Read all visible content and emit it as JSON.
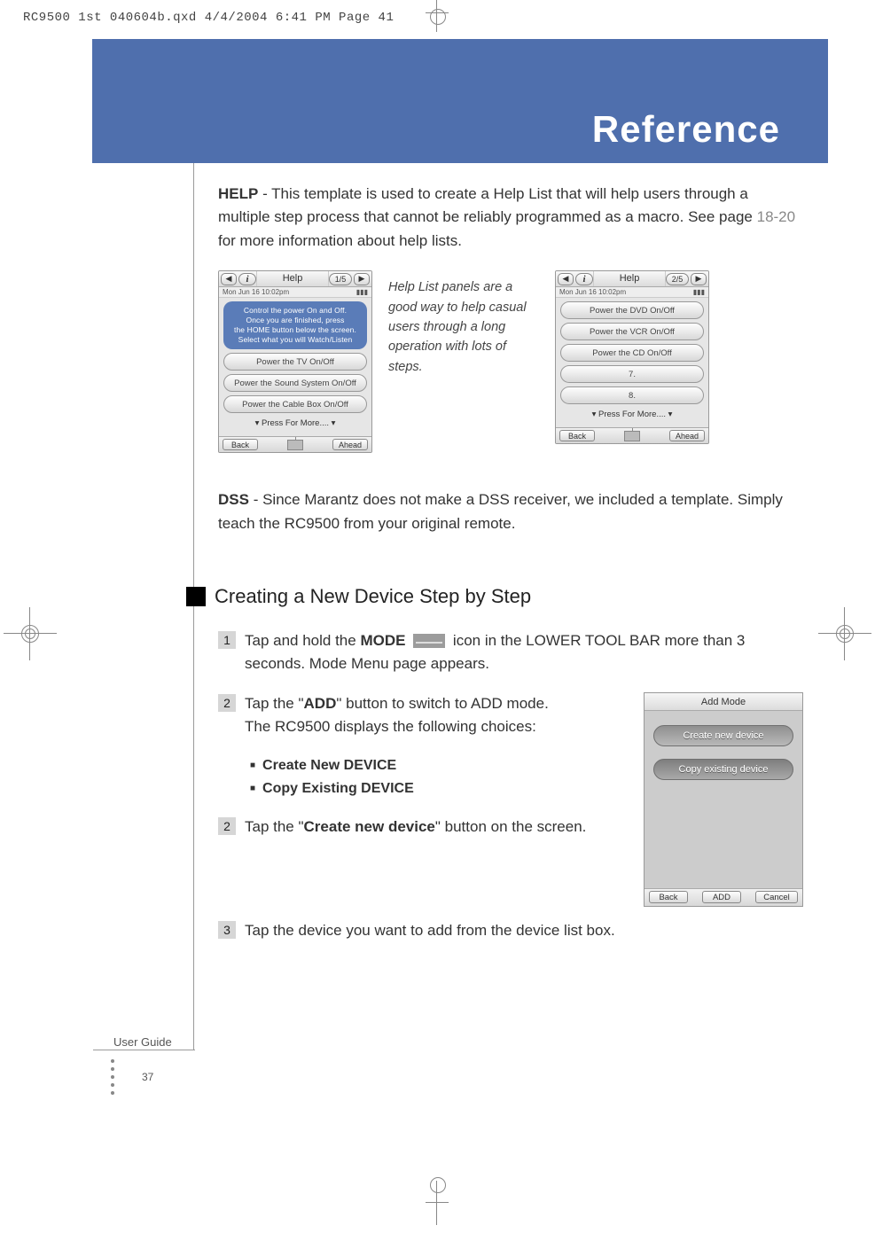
{
  "print_header": "RC9500 1st 040604b.qxd  4/4/2004  6:41 PM  Page 41",
  "banner_title": "Reference",
  "para_help": {
    "lead": "HELP",
    "body1": " - This template is used to create a Help List that will help users through a multiple step process that cannot be reliably programmed as a macro.  See page ",
    "pages": "18-20",
    "body2": " for more information about help lists."
  },
  "caption": "Help List panels are a good way to help casual users through a long operation with lots of steps.",
  "lcd1": {
    "title": "Help",
    "page": "1/5",
    "status_left": "Mon Jun 16  10:02pm",
    "blue_l1": "Control the power On and Off.",
    "blue_l2": "Once you are finished, press",
    "blue_l3": "the HOME button below the screen.",
    "blue_l4": "Select what you will Watch/Listen",
    "b1": "Power the TV On/Off",
    "b2": "Power the Sound System On/Off",
    "b3": "Power the Cable Box On/Off",
    "more": "▾ Press For More.... ▾",
    "back": "Back",
    "ahead": "Ahead"
  },
  "lcd2": {
    "title": "Help",
    "page": "2/5",
    "status_left": "Mon Jun 16  10:02pm",
    "b1": "Power the DVD On/Off",
    "b2": "Power the VCR On/Off",
    "b3": "Power the CD On/Off",
    "b4": "7.",
    "b5": "8.",
    "more": "▾ Press For More.... ▾",
    "back": "Back",
    "ahead": "Ahead"
  },
  "para_dss": {
    "lead": "DSS",
    "body": " - Since Marantz does not make a DSS receiver, we included a template. Simply teach the RC9500 from your original remote."
  },
  "h2": "Creating a New Device Step by Step",
  "step1": {
    "pre": "Tap and hold the ",
    "mode": "MODE",
    "post": " icon in the LOWER TOOL BAR more than 3 seconds. Mode Menu page appears."
  },
  "step2a": {
    "l1a": "Tap the \"",
    "l1b": "ADD",
    "l1c": "\" button to switch to ADD mode.",
    "l2": "The RC9500 displays the following choices:"
  },
  "bullets": {
    "b1": "Create New DEVICE",
    "b2": "Copy Existing DEVICE"
  },
  "step2b": {
    "l1a": "Tap the \"",
    "l1b": "Create new device",
    "l1c": "\" button on the screen."
  },
  "step3": "Tap the device you want to add from the device list box.",
  "addmode": {
    "title": "Add Mode",
    "b1": "Create new device",
    "b2": "Copy existing device",
    "back": "Back",
    "mid": "ADD",
    "cancel": "Cancel"
  },
  "footer": {
    "ug": "User Guide",
    "page": "37"
  }
}
